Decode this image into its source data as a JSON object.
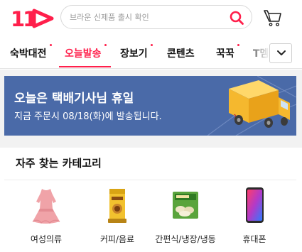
{
  "header": {
    "logo_text": "11",
    "search_placeholder": "브라운 신제품 출시 확인"
  },
  "tabs": [
    {
      "label": "숙박대전",
      "dot": true
    },
    {
      "label": "오늘발송",
      "dot": true,
      "active": true
    },
    {
      "label": "장보기",
      "dot": true
    },
    {
      "label": "콘텐츠",
      "dot": false
    },
    {
      "label": "꾹꾹",
      "dot": true
    },
    {
      "label": "T멤",
      "dot": false
    }
  ],
  "banner": {
    "title": "오늘은 택배기사님 휴일",
    "subtitle": "지금 주문시 08/18(화)에 발송됩니다."
  },
  "section": {
    "title": "자주 찾는 카테고리"
  },
  "categories": [
    {
      "label": "여성의류",
      "icon": "dress-icon"
    },
    {
      "label": "커피/음료",
      "icon": "coffee-pack-icon"
    },
    {
      "label": "간편식/냉장/냉동",
      "icon": "dumpling-pack-icon"
    },
    {
      "label": "휴대폰",
      "icon": "smartphone-icon"
    }
  ],
  "colors": {
    "accent": "#ff1f4b",
    "banner_bg": "#4a6aa8",
    "truck": "#f5b82e"
  }
}
